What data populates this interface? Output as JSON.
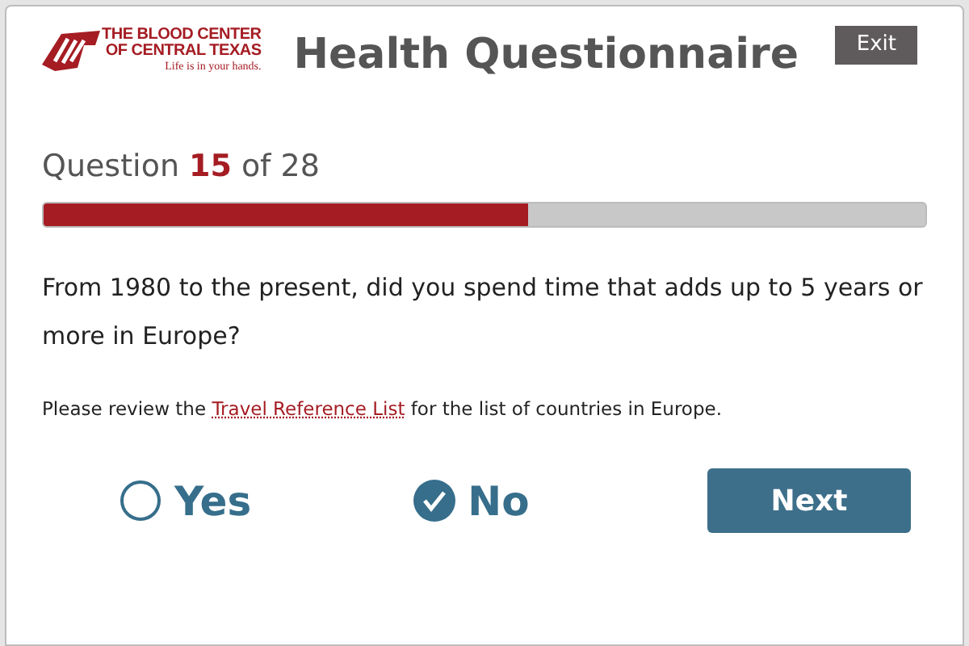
{
  "logo": {
    "line_1": "THE BLOOD CENTER",
    "line_2": "OF CENTRAL TEXAS",
    "tagline": "Life is in your hands."
  },
  "title": "Health Questionnaire",
  "exit_button": "Exit",
  "progress": {
    "prefix": "Question",
    "current": "15",
    "suffix": "of 28",
    "level": 0.55
  },
  "question": "From 1980 to the present, did you spend time that adds up to 5 years or more in Europe?",
  "note": {
    "before": "Please review the",
    "link": "Travel Reference List",
    "after": "for the list of countries in Europe."
  },
  "answers": [
    {
      "label": "Yes",
      "selected": false
    },
    {
      "label": "No",
      "selected": true
    }
  ],
  "next_button": "Next"
}
